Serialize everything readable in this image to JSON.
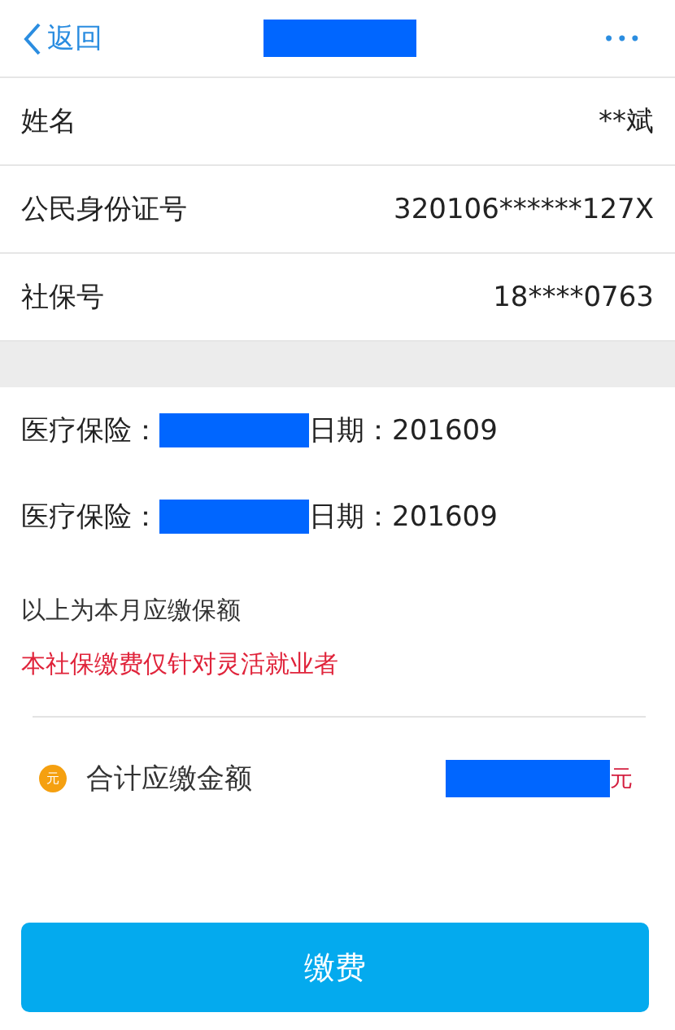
{
  "nav": {
    "back": "返回",
    "title_redacted": true,
    "more": "•••"
  },
  "info_rows": [
    {
      "label": "姓名",
      "value": "**斌"
    },
    {
      "label": "公民身份证号",
      "value": "320106******127X"
    },
    {
      "label": "社保号",
      "value": "18****0763"
    }
  ],
  "items": [
    {
      "label": "医疗保险：",
      "redacted": true,
      "date_label": "日期：",
      "date": "201609"
    },
    {
      "label": "医疗保险：",
      "redacted": true,
      "date_label": "日期：",
      "date": "201609"
    }
  ],
  "note": "以上为本月应缴保额",
  "warning": "本社保缴费仅针对灵活就业者",
  "total": {
    "coin": "元",
    "label": "合计应缴金额",
    "amount_redacted": true,
    "unit": "元"
  },
  "pay_button": "缴费"
}
